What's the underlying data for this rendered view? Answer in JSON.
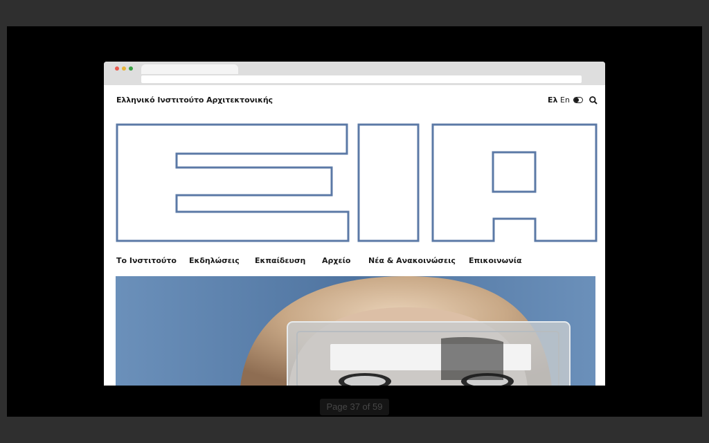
{
  "site": {
    "title": "Ελληνικό Ινστιτούτο Αρχιτεκτονικής",
    "lang_el": "Ελ",
    "lang_en": "En"
  },
  "nav": {
    "items": [
      {
        "label": "Το Ινστιτούτο"
      },
      {
        "label": "Εκδηλώσεις"
      },
      {
        "label": "Εκπαίδευση"
      },
      {
        "label": "Αρχείο"
      },
      {
        "label": "Νέα & Ανακοινώσεις"
      },
      {
        "label": "Επικοινωνία"
      }
    ]
  },
  "viewer": {
    "page_indicator": "Page 37 of 59"
  },
  "colors": {
    "logo_stroke": "#5b79a6",
    "viewer_bg": "#000000",
    "window_bg": "#2f2f2f",
    "hero_sky": "#5d83ad",
    "dot_red": "#ea5a4f",
    "dot_yellow": "#e8b53a",
    "dot_green": "#3aa244"
  },
  "icons": {
    "theme_toggle": "toggle-icon",
    "search": "search-icon"
  }
}
